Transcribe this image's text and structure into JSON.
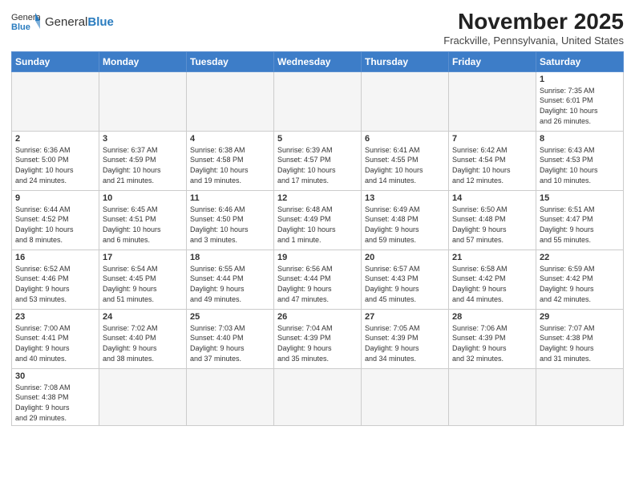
{
  "header": {
    "logo_text_normal": "General",
    "logo_text_bold": "Blue",
    "month_title": "November 2025",
    "subtitle": "Frackville, Pennsylvania, United States"
  },
  "days_of_week": [
    "Sunday",
    "Monday",
    "Tuesday",
    "Wednesday",
    "Thursday",
    "Friday",
    "Saturday"
  ],
  "weeks": [
    [
      {
        "day": "",
        "info": ""
      },
      {
        "day": "",
        "info": ""
      },
      {
        "day": "",
        "info": ""
      },
      {
        "day": "",
        "info": ""
      },
      {
        "day": "",
        "info": ""
      },
      {
        "day": "",
        "info": ""
      },
      {
        "day": "1",
        "info": "Sunrise: 7:35 AM\nSunset: 6:01 PM\nDaylight: 10 hours\nand 26 minutes."
      }
    ],
    [
      {
        "day": "2",
        "info": "Sunrise: 6:36 AM\nSunset: 5:00 PM\nDaylight: 10 hours\nand 24 minutes."
      },
      {
        "day": "3",
        "info": "Sunrise: 6:37 AM\nSunset: 4:59 PM\nDaylight: 10 hours\nand 21 minutes."
      },
      {
        "day": "4",
        "info": "Sunrise: 6:38 AM\nSunset: 4:58 PM\nDaylight: 10 hours\nand 19 minutes."
      },
      {
        "day": "5",
        "info": "Sunrise: 6:39 AM\nSunset: 4:57 PM\nDaylight: 10 hours\nand 17 minutes."
      },
      {
        "day": "6",
        "info": "Sunrise: 6:41 AM\nSunset: 4:55 PM\nDaylight: 10 hours\nand 14 minutes."
      },
      {
        "day": "7",
        "info": "Sunrise: 6:42 AM\nSunset: 4:54 PM\nDaylight: 10 hours\nand 12 minutes."
      },
      {
        "day": "8",
        "info": "Sunrise: 6:43 AM\nSunset: 4:53 PM\nDaylight: 10 hours\nand 10 minutes."
      }
    ],
    [
      {
        "day": "9",
        "info": "Sunrise: 6:44 AM\nSunset: 4:52 PM\nDaylight: 10 hours\nand 8 minutes."
      },
      {
        "day": "10",
        "info": "Sunrise: 6:45 AM\nSunset: 4:51 PM\nDaylight: 10 hours\nand 6 minutes."
      },
      {
        "day": "11",
        "info": "Sunrise: 6:46 AM\nSunset: 4:50 PM\nDaylight: 10 hours\nand 3 minutes."
      },
      {
        "day": "12",
        "info": "Sunrise: 6:48 AM\nSunset: 4:49 PM\nDaylight: 10 hours\nand 1 minute."
      },
      {
        "day": "13",
        "info": "Sunrise: 6:49 AM\nSunset: 4:48 PM\nDaylight: 9 hours\nand 59 minutes."
      },
      {
        "day": "14",
        "info": "Sunrise: 6:50 AM\nSunset: 4:48 PM\nDaylight: 9 hours\nand 57 minutes."
      },
      {
        "day": "15",
        "info": "Sunrise: 6:51 AM\nSunset: 4:47 PM\nDaylight: 9 hours\nand 55 minutes."
      }
    ],
    [
      {
        "day": "16",
        "info": "Sunrise: 6:52 AM\nSunset: 4:46 PM\nDaylight: 9 hours\nand 53 minutes."
      },
      {
        "day": "17",
        "info": "Sunrise: 6:54 AM\nSunset: 4:45 PM\nDaylight: 9 hours\nand 51 minutes."
      },
      {
        "day": "18",
        "info": "Sunrise: 6:55 AM\nSunset: 4:44 PM\nDaylight: 9 hours\nand 49 minutes."
      },
      {
        "day": "19",
        "info": "Sunrise: 6:56 AM\nSunset: 4:44 PM\nDaylight: 9 hours\nand 47 minutes."
      },
      {
        "day": "20",
        "info": "Sunrise: 6:57 AM\nSunset: 4:43 PM\nDaylight: 9 hours\nand 45 minutes."
      },
      {
        "day": "21",
        "info": "Sunrise: 6:58 AM\nSunset: 4:42 PM\nDaylight: 9 hours\nand 44 minutes."
      },
      {
        "day": "22",
        "info": "Sunrise: 6:59 AM\nSunset: 4:42 PM\nDaylight: 9 hours\nand 42 minutes."
      }
    ],
    [
      {
        "day": "23",
        "info": "Sunrise: 7:00 AM\nSunset: 4:41 PM\nDaylight: 9 hours\nand 40 minutes."
      },
      {
        "day": "24",
        "info": "Sunrise: 7:02 AM\nSunset: 4:40 PM\nDaylight: 9 hours\nand 38 minutes."
      },
      {
        "day": "25",
        "info": "Sunrise: 7:03 AM\nSunset: 4:40 PM\nDaylight: 9 hours\nand 37 minutes."
      },
      {
        "day": "26",
        "info": "Sunrise: 7:04 AM\nSunset: 4:39 PM\nDaylight: 9 hours\nand 35 minutes."
      },
      {
        "day": "27",
        "info": "Sunrise: 7:05 AM\nSunset: 4:39 PM\nDaylight: 9 hours\nand 34 minutes."
      },
      {
        "day": "28",
        "info": "Sunrise: 7:06 AM\nSunset: 4:39 PM\nDaylight: 9 hours\nand 32 minutes."
      },
      {
        "day": "29",
        "info": "Sunrise: 7:07 AM\nSunset: 4:38 PM\nDaylight: 9 hours\nand 31 minutes."
      }
    ],
    [
      {
        "day": "30",
        "info": "Sunrise: 7:08 AM\nSunset: 4:38 PM\nDaylight: 9 hours\nand 29 minutes."
      },
      {
        "day": "",
        "info": ""
      },
      {
        "day": "",
        "info": ""
      },
      {
        "day": "",
        "info": ""
      },
      {
        "day": "",
        "info": ""
      },
      {
        "day": "",
        "info": ""
      },
      {
        "day": "",
        "info": ""
      }
    ]
  ],
  "colors": {
    "header_bg": "#3d7dc8",
    "header_text": "#ffffff",
    "border": "#cccccc",
    "empty_bg": "#f5f5f5",
    "logo_blue": "#2a7cbf"
  }
}
